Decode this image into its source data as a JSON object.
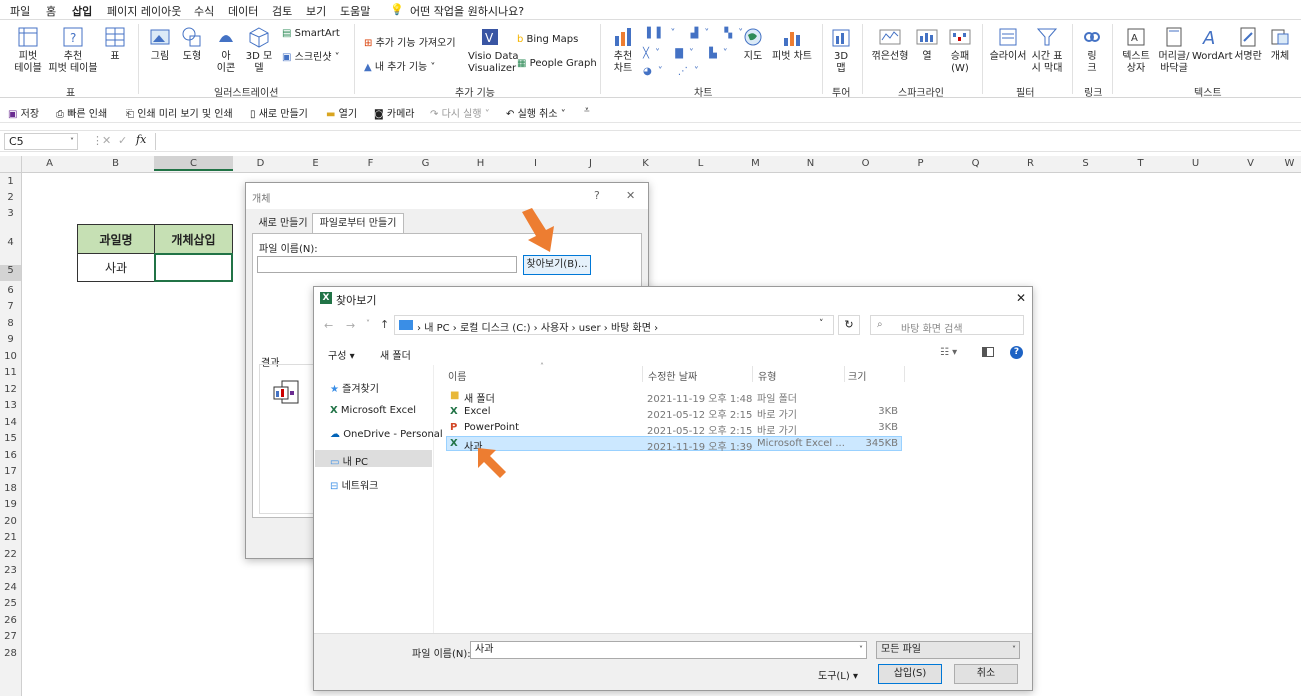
{
  "menu": {
    "items": [
      "파일",
      "홈",
      "삽입",
      "페이지 레이아웃",
      "수식",
      "데이터",
      "검토",
      "보기",
      "도움말"
    ],
    "tell_me": "어떤 작업을 원하시나요?"
  },
  "ribbon": {
    "pivot": "피벗\n테이블",
    "rec_pivot": "추천\n피벗 테이블",
    "table": "표",
    "group_table": "표",
    "picture": "그림",
    "shape": "도형",
    "icon": "아\n이콘",
    "model3d": "3D 모\n델",
    "smartart": "SmartArt",
    "screenshot": "스크린샷",
    "group_illus": "일러스트레이션",
    "get_addin": "추가 기능 가져오기",
    "my_addin": "내 추가 기능",
    "visio": "Visio Data\nVisualizer",
    "bing": "Bing Maps",
    "people": "People Graph",
    "group_addin": "추가 기능",
    "rec_chart": "추천\n차트",
    "map": "지도",
    "pivot_chart": "피벗 차트",
    "group_chart": "차트",
    "map3d": "3D\n맵",
    "group_tour": "투어",
    "sp_line": "꺾은선형",
    "sp_col": "열",
    "sp_wl": "승패\n(W)",
    "group_spark": "스파크라인",
    "slicer": "슬라이서",
    "timeline": "시간 표\n시 막대",
    "group_filter": "필터",
    "link": "링\n크",
    "group_link": "링크",
    "textbox": "텍스트\n상자",
    "header": "머리글/\n바닥글",
    "wordart": "WordArt",
    "signature": "서명란",
    "object": "개체",
    "group_text": "텍스트"
  },
  "qat": {
    "save": "저장",
    "quick_print": "빠른 인쇄",
    "preview": "인쇄 미리 보기 및 인쇄",
    "new": "새로 만들기",
    "open": "열기",
    "camera": "카메라",
    "redo": "다시 실행",
    "undo": "실행 취소"
  },
  "formula_bar": {
    "name_box": "C5",
    "fx": "fx"
  },
  "columns": [
    "A",
    "B",
    "C",
    "D",
    "E",
    "F",
    "G",
    "H",
    "I",
    "J",
    "K",
    "L",
    "M",
    "N",
    "O",
    "P",
    "Q",
    "R",
    "S",
    "T",
    "U",
    "V",
    "W"
  ],
  "rows": [
    "1",
    "2",
    "3",
    "4",
    "5",
    "6",
    "7",
    "8",
    "9",
    "10",
    "11",
    "12",
    "13",
    "14",
    "15",
    "16",
    "17",
    "18",
    "19",
    "20",
    "21",
    "22",
    "23",
    "24",
    "25",
    "26",
    "27",
    "28"
  ],
  "sheet": {
    "h1": "과일명",
    "h2": "개체삽입",
    "v1": "사과"
  },
  "object_dialog": {
    "title": "개체",
    "help": "?",
    "close": "✕",
    "tab_new": "새로 만들기",
    "tab_file": "파일로부터 만들기",
    "file_label": "파일 이름(N):",
    "browse": "찾아보기(B)...",
    "result": "결과"
  },
  "browse_dialog": {
    "title": "찾아보기",
    "close": "✕",
    "path": [
      "내 PC",
      "로컬 디스크 (C:)",
      "사용자",
      "user",
      "바탕 화면"
    ],
    "search_placeholder": "바탕 화면 검색",
    "organize": "구성",
    "new_folder": "새 폴더",
    "tree": [
      "즐겨찾기",
      "Microsoft Excel",
      "OneDrive - Personal",
      "내 PC",
      "네트워크"
    ],
    "cols": [
      "이름",
      "수정한 날짜",
      "유형",
      "크기"
    ],
    "files": [
      {
        "name": "새 폴더",
        "date": "2021-11-19 오후 1:48",
        "type": "파일 폴더",
        "size": ""
      },
      {
        "name": "Excel",
        "date": "2021-05-12 오후 2:15",
        "type": "바로 가기",
        "size": "3KB"
      },
      {
        "name": "PowerPoint",
        "date": "2021-05-12 오후 2:15",
        "type": "바로 가기",
        "size": "3KB"
      },
      {
        "name": "사과",
        "date": "2021-11-19 오후 1:39",
        "type": "Microsoft Excel ...",
        "size": "345KB"
      }
    ],
    "filename_label": "파일 이름(N):",
    "filename_value": "사과",
    "filter": "모든 파일",
    "tools": "도구(L)",
    "insert": "삽입(S)",
    "cancel": "취소"
  },
  "colors": {
    "excel_green": "#217346",
    "selected_row": "#cce8ff",
    "header_fill": "#c6e0b4",
    "arrow": "#ed7d31"
  }
}
